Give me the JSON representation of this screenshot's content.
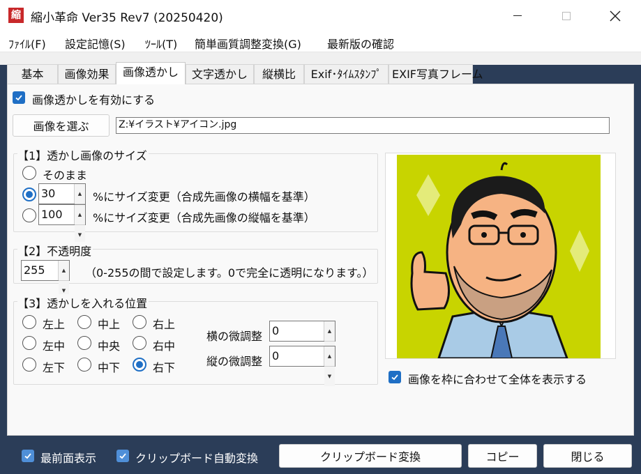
{
  "window": {
    "title": "縮小革命 Ver35 Rev7 (20250420)",
    "app_icon_char": "縮",
    "minimize_glyph": "—",
    "close_glyph": "✕"
  },
  "menu": [
    "ﾌｧｲﾙ(F)",
    "設定記憶(S)",
    "ﾂｰﾙ(T)",
    "簡単画質調整変換(G)",
    "最新版の確認"
  ],
  "tabs": [
    "基本",
    "画像効果",
    "画像透かし",
    "文字透かし",
    "縦横比",
    "Exif･ﾀｲﾑｽﾀﾝﾌﾟ",
    "EXIF写真フレーム"
  ],
  "active_tab": "画像透かし",
  "watermark": {
    "enable_label": "画像透かしを有効にする",
    "enable_checked": true,
    "choose_image_button": "画像を選ぶ",
    "image_path": "Z:¥イラスト¥アイコン.jpg"
  },
  "size_group": {
    "title": "【1】透かし画像のサイズ",
    "option_asis": "そのまま",
    "width_value": "30",
    "width_label": "%にサイズ変更（合成先画像の横幅を基準）",
    "height_value": "100",
    "height_label": "%にサイズ変更（合成先画像の縦幅を基準）",
    "selected": "width"
  },
  "opacity_group": {
    "title": "【2】不透明度",
    "value": "255",
    "note": "（0-255の間で設定します。0で完全に透明になります。）"
  },
  "position_group": {
    "title": "【3】透かしを入れる位置",
    "positions": [
      "左上",
      "中上",
      "右上",
      "左中",
      "中央",
      "右中",
      "左下",
      "中下",
      "右下"
    ],
    "selected": "右下",
    "h_adjust_label": "横の微調整",
    "h_adjust_value": "0",
    "v_adjust_label": "縦の微調整",
    "v_adjust_value": "0"
  },
  "preview": {
    "fit_label": "画像を枠に合わせて全体を表示する",
    "fit_checked": true,
    "bg_color": "#c8d400"
  },
  "bottom": {
    "topmost_label": "最前面表示",
    "topmost_checked": true,
    "clipboard_auto_label": "クリップボード自動変換",
    "clipboard_auto_checked": true,
    "clipboard_convert_button": "クリップボード変換",
    "copy_button": "コピー",
    "close_button": "閉じる"
  },
  "colors": {
    "frame": "#2b3d58",
    "accent": "#1f6fc5",
    "icon_red": "#c8282a"
  }
}
